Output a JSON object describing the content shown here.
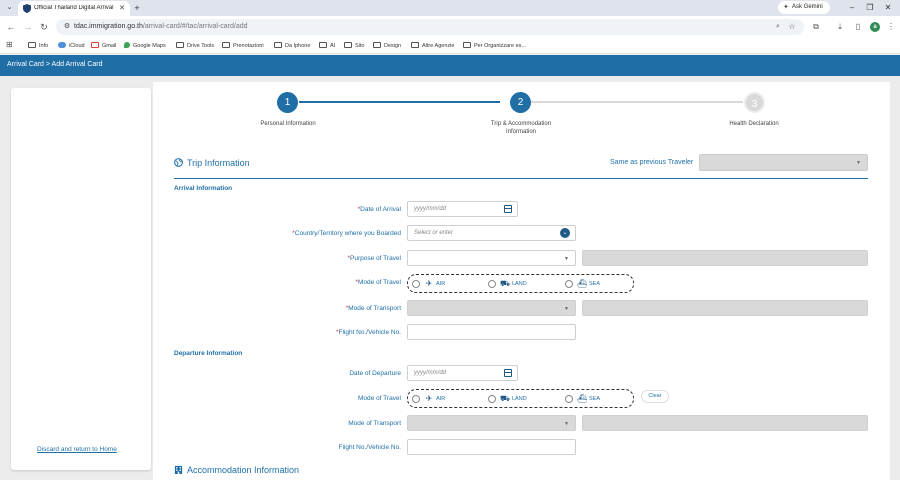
{
  "browser": {
    "tab_title": "Official Thailand Digital Arrival",
    "url_host": "tdac.immigration.go.th",
    "url_path": "/arrival-card/#/tac/arrival-card/add",
    "gemini_label": "Ask Gemini",
    "profile_initial": "a",
    "bookmarks": [
      "Info",
      "iCloud",
      "Gmail",
      "Google Maps",
      "Drive Tools",
      "Prenotazioni",
      "Da Iphone",
      "AI",
      "Sito",
      "Design",
      "Altre Agenzie",
      "Per Organizzare es..."
    ]
  },
  "header": {
    "breadcrumb": "Arrival Card > Add Arrival Card"
  },
  "sidebar": {
    "discard_link": "Discard and return to Home"
  },
  "steps": [
    {
      "number": "1",
      "label": "Personal Information",
      "state": "complete"
    },
    {
      "number": "2",
      "label": "Trip & Accommodation Information",
      "state": "active"
    },
    {
      "number": "3",
      "label": "Health Declaration",
      "state": "inactive"
    }
  ],
  "trip": {
    "title": "Trip Information",
    "same_as_label": "Same as previous Traveler",
    "arrival_heading": "Arrival Information",
    "departure_heading": "Departure Information"
  },
  "arrival": {
    "date_label": "Date of Arrival",
    "date_placeholder": "yyyy/mm/dd",
    "country_label": "Country/Territory where you Boarded",
    "country_placeholder": "Select or enter",
    "purpose_label": "Purpose of Travel",
    "mode_label": "Mode of Travel",
    "transport_label": "Mode of Transport",
    "flight_label": "Flight No./Vehicle No."
  },
  "departure": {
    "date_label": "Date of Departure",
    "date_placeholder": "yyyy/mm/dd",
    "mode_label": "Mode of Travel",
    "transport_label": "Mode of Transport",
    "flight_label": "Flight No./Vehicle No.",
    "clear_label": "Clear"
  },
  "travel_modes": [
    "AIR",
    "LAND",
    "SEA"
  ],
  "accommodation": {
    "title": "Accommodation Information"
  },
  "colors": {
    "primary": "#1f6fa6",
    "required": "#d32f2f",
    "disabled": "#d9d9d9"
  }
}
